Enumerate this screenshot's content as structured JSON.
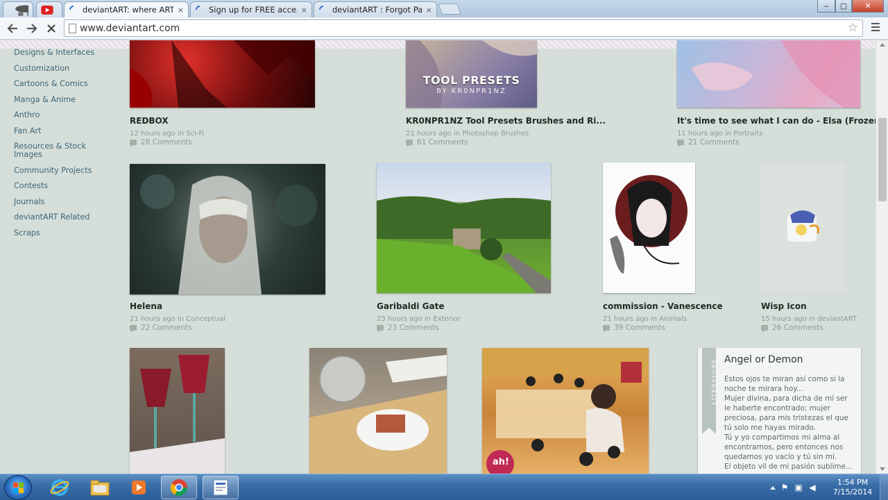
{
  "browser": {
    "tabs": [
      {
        "label": "",
        "icon": "incognito-icon"
      },
      {
        "label": "",
        "icon": "youtube-icon"
      },
      {
        "label": "deviantART: where ART m",
        "icon": "loading-icon",
        "active": true
      },
      {
        "label": "Sign up for FREE access to",
        "icon": "loading-icon"
      },
      {
        "label": "deviantART : Forgot Passw",
        "icon": "loading-icon"
      }
    ],
    "close_glyph": "×",
    "url": "www.deviantart.com",
    "window_controls": {
      "minimize": "–",
      "maximize": "▢",
      "close": "✕"
    }
  },
  "sidebar": {
    "items": [
      "Designs & Interfaces",
      "Customization",
      "Cartoons & Comics",
      "Manga & Anime",
      "Anthro",
      "Fan Art",
      "Resources & Stock Images",
      "Community Projects",
      "Contests",
      "Journals",
      "deviantART Related",
      "Scraps"
    ]
  },
  "gallery": {
    "row1": [
      {
        "title": "REDBOX",
        "time": "12 hours ago in",
        "category": "Sci-Fi",
        "comments": "28 Comments"
      },
      {
        "title": "KR0NPR1NZ Tool Presets Brushes and Ri...",
        "time": "21 hours ago in",
        "category": "Photoshop Brushes",
        "comments": "61 Comments",
        "thumb_text": "TOOL PRESETS",
        "thumb_subtext": "BY KR0NPR1NZ"
      },
      {
        "title": "It's time to see what I can do - Elsa (Frozen)",
        "time": "11 hours ago in",
        "category": "Portraits",
        "comments": "21 Comments"
      }
    ],
    "row2": [
      {
        "title": "Helena",
        "time": "21 hours ago in",
        "category": "Conceptual",
        "comments": "22 Comments"
      },
      {
        "title": "Garibaldi Gate",
        "time": "23 hours ago in",
        "category": "Exterior",
        "comments": "23 Comments"
      },
      {
        "title": "commission - Vanescence",
        "time": "21 hours ago in",
        "category": "Animals",
        "comments": "39 Comments"
      },
      {
        "title": "Wisp Icon",
        "time": "15 hours ago in",
        "category": "deviantART",
        "comments": "26 Comments"
      }
    ],
    "row3_thumb_badge": "ah!"
  },
  "literature": {
    "label": "LITERATURE",
    "title": "Angel or Demon",
    "body": "Estos ojos te miran así como si la noche te mirara hoy...\nMujer divina, para dicha de mí ser le haberte encontrado; mujer preciosa, para mis tristezas el que tú solo me hayas mirado.\nTú y yo compartimos mi alma al encontrarnos, pero entonces nos quedamos yo vacío y tú sin mí.\nEl objeto vil de mi pasión sublime..."
  },
  "taskbar": {
    "time": "1:54 PM",
    "date": "7/15/2014",
    "apps": [
      "internet-explorer-icon",
      "file-explorer-icon",
      "media-player-icon",
      "chrome-icon",
      "document-app-icon"
    ]
  },
  "colors": {
    "page_bg": "#d6ded9",
    "link": "#3d6678",
    "title": "#1d2a22",
    "meta": "#8a9a92"
  }
}
